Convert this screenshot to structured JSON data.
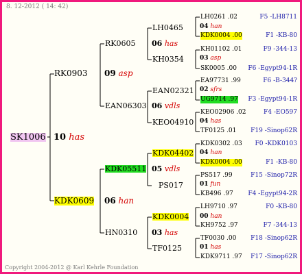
{
  "header_date": "8. 12-2012 ( 14: 42)",
  "footer": "Copyright 2004-2012 @ Karl Kehrle Foundation",
  "root": {
    "id": "SK1006",
    "gen": "10",
    "breed": "has"
  },
  "gen1": [
    {
      "id": "RK0903",
      "gen": "09",
      "breed": "asp"
    },
    {
      "id": "KDK0609",
      "gen": "06",
      "breed": "han"
    }
  ],
  "gen2": [
    {
      "id": "RK0605",
      "gen": "06",
      "breed": "has"
    },
    {
      "id": "EAN06303",
      "gen": "06",
      "breed": "vdls"
    },
    {
      "id": "KDK05511",
      "gen": "05",
      "breed": "vdls"
    },
    {
      "id": "HN0310",
      "gen": "03",
      "breed": "has"
    }
  ],
  "gen3": [
    {
      "id": "LH0465",
      "gen": "04",
      "breed": "han"
    },
    {
      "id": "KH0354",
      "gen": "03",
      "breed": "asp"
    },
    {
      "id": "EAN02321",
      "gen": "02",
      "breed": "sfrs"
    },
    {
      "id": "KEO04910",
      "gen": "04",
      "breed": "has"
    },
    {
      "id": "KDK04402",
      "gen": "04",
      "breed": "han"
    },
    {
      "id": "PS017",
      "gen": "01",
      "breed": "fun"
    },
    {
      "id": "KDK0004",
      "gen": "00",
      "breed": "han"
    },
    {
      "id": "TF0125",
      "gen": "01",
      "breed": "has"
    }
  ],
  "gen4": [
    {
      "id": "LH0261 .02",
      "ref": "F5 -LH8711"
    },
    {
      "id": "KDK0004 .00",
      "ref": "F1 -KB-80"
    },
    {
      "id": "KH01102 .01",
      "ref": "F9 -344-13"
    },
    {
      "id": "SK0005 .00",
      "ref": "F6 -Egypt94-1R"
    },
    {
      "id": "EA97731 .99",
      "ref": "F6 -B-344?"
    },
    {
      "id": "UG9714 .97",
      "ref": "F3 -Egypt94-1R"
    },
    {
      "id": "KEO02906 .02",
      "ref": "F4 -EO597"
    },
    {
      "id": "TF0125 .01",
      "ref": "F19 -Sinop62R"
    },
    {
      "id": "KDK0302 .03",
      "ref": "F0 -KDK0103"
    },
    {
      "id": "KDK0004 .00",
      "ref": "F1 -KB-80"
    },
    {
      "id": "PS517 .99",
      "ref": "F15 -Sinop72R"
    },
    {
      "id": "KB496 .97",
      "ref": "F4 -Egypt94-2R"
    },
    {
      "id": "LH9710 .97",
      "ref": "F0 -KB-80"
    },
    {
      "id": "KH9752 .97",
      "ref": "F7 -344-13"
    },
    {
      "id": "TF0030 .00",
      "ref": "F18 -Sinop62R"
    },
    {
      "id": "KDK9711 .97",
      "ref": "F17 -Sinop62R"
    }
  ]
}
